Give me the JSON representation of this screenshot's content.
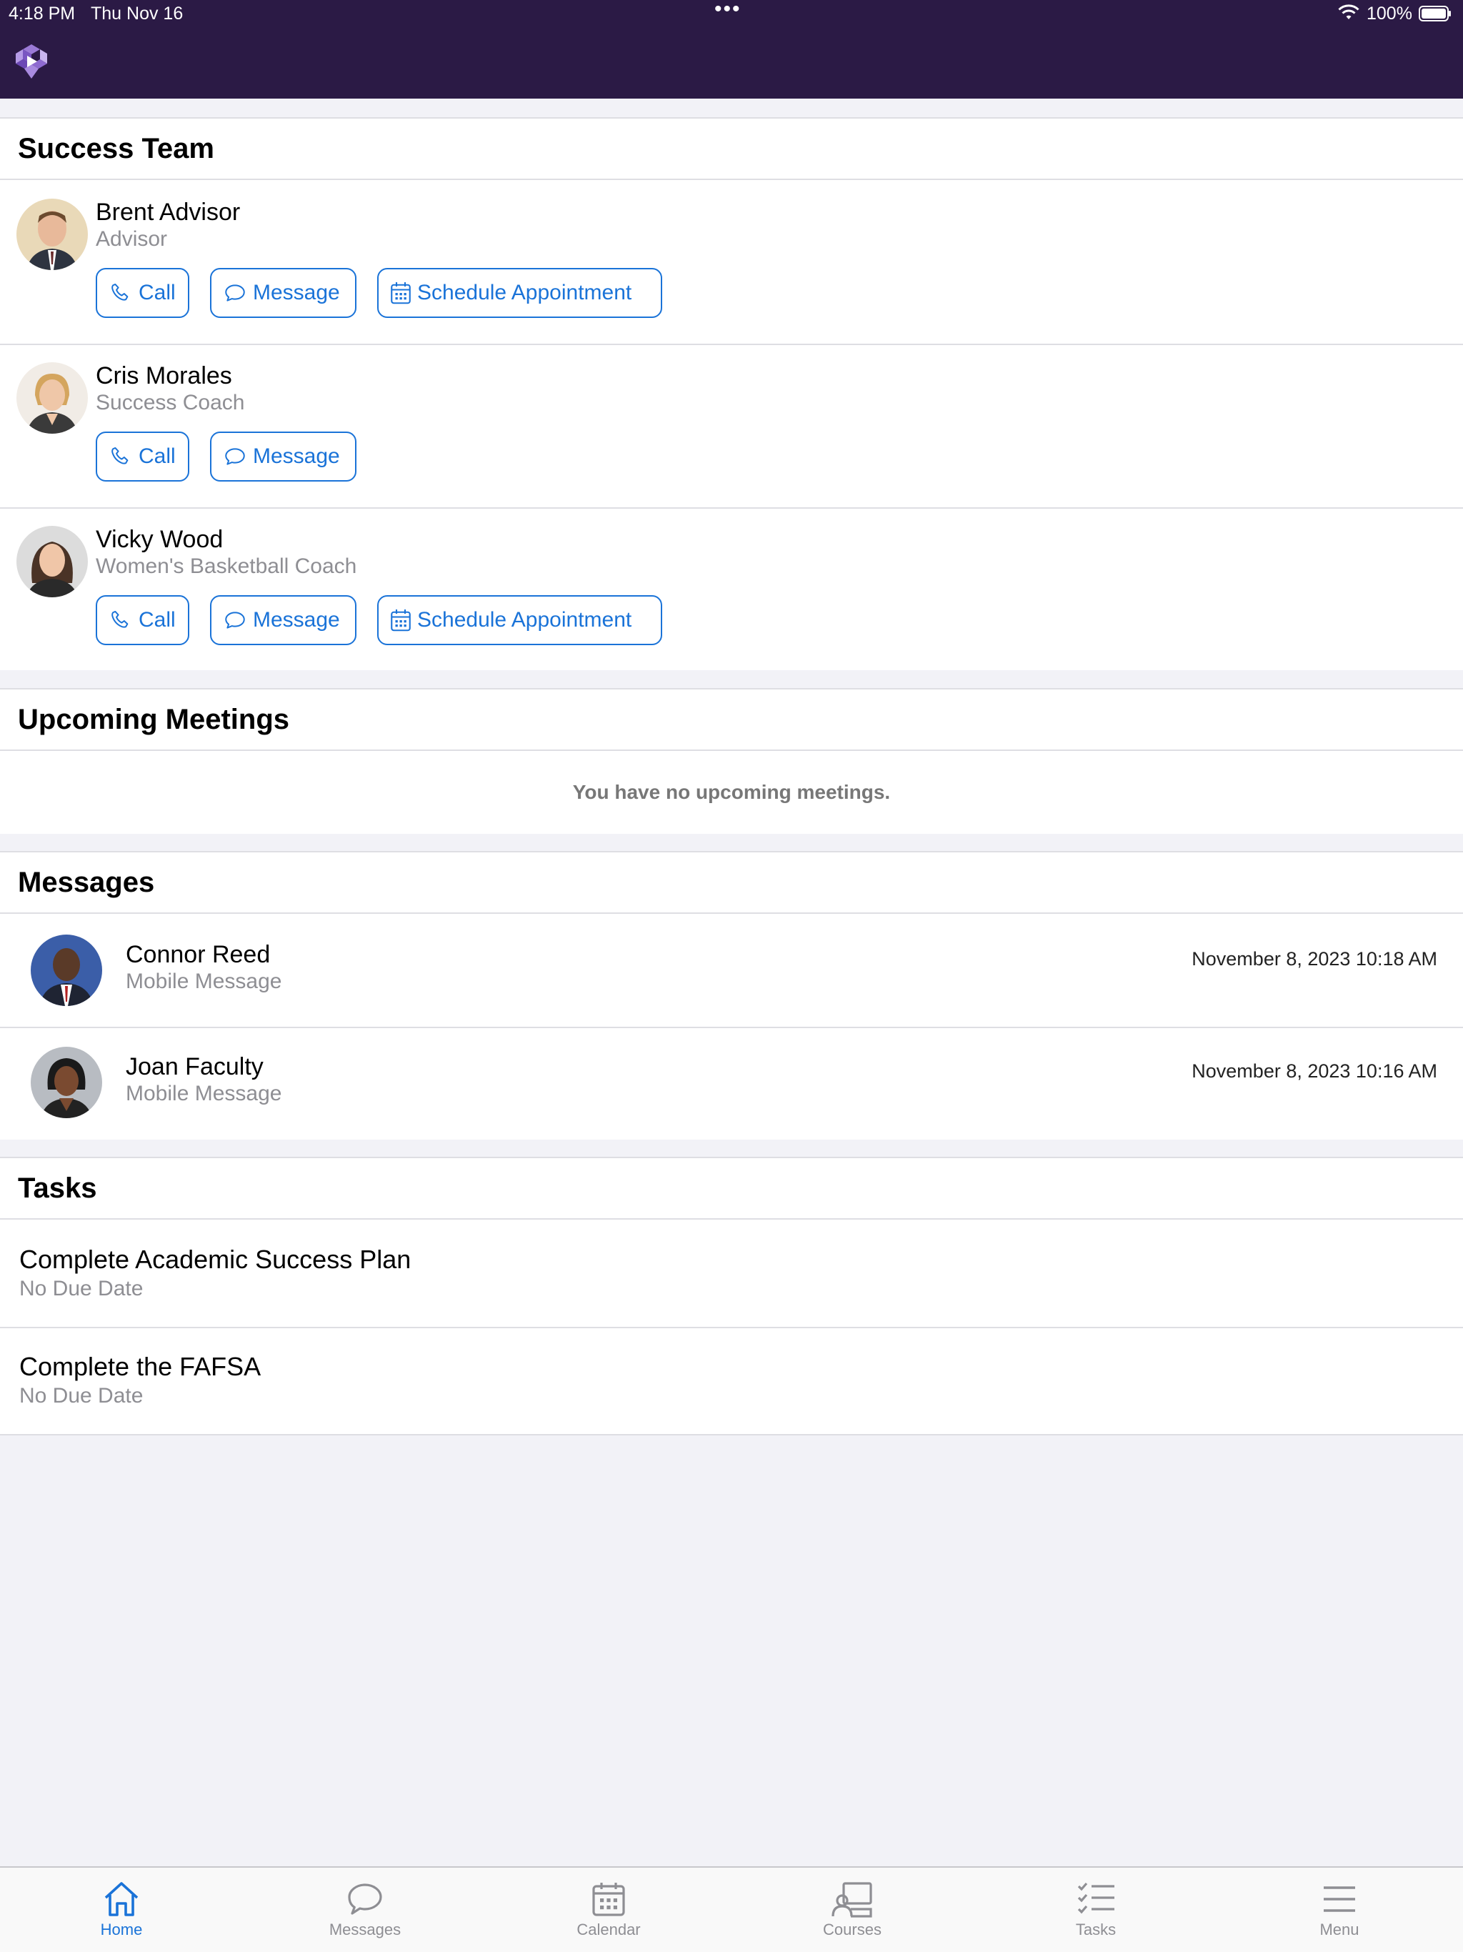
{
  "status": {
    "time": "4:18 PM",
    "date": "Thu Nov 16",
    "multitask_dots": "•••",
    "battery": "100%"
  },
  "success_team": {
    "title": "Success Team",
    "members": [
      {
        "name": "Brent Advisor",
        "role": "Advisor",
        "call": "Call",
        "message": "Message",
        "schedule": "Schedule Appointment"
      },
      {
        "name": "Cris Morales",
        "role": "Success Coach",
        "call": "Call",
        "message": "Message"
      },
      {
        "name": "Vicky Wood",
        "role": "Women's Basketball Coach",
        "call": "Call",
        "message": "Message",
        "schedule": "Schedule Appointment"
      }
    ]
  },
  "meetings": {
    "title": "Upcoming Meetings",
    "empty": "You have no upcoming meetings."
  },
  "messages": {
    "title": "Messages",
    "items": [
      {
        "name": "Connor Reed",
        "type": "Mobile Message",
        "date": "November 8, 2023 10:18 AM"
      },
      {
        "name": "Joan Faculty",
        "type": "Mobile Message",
        "date": "November 8, 2023 10:16 AM"
      }
    ]
  },
  "tasks": {
    "title": "Tasks",
    "items": [
      {
        "title": "Complete Academic Success Plan",
        "due": "No Due Date"
      },
      {
        "title": "Complete the FAFSA",
        "due": "No Due Date"
      }
    ]
  },
  "tabs": [
    {
      "label": "Home",
      "icon": "home-icon",
      "active": true
    },
    {
      "label": "Messages",
      "icon": "chat-bubble-icon"
    },
    {
      "label": "Calendar",
      "icon": "calendar-icon"
    },
    {
      "label": "Courses",
      "icon": "courses-icon"
    },
    {
      "label": "Tasks",
      "icon": "checklist-icon"
    },
    {
      "label": "Menu",
      "icon": "hamburger-menu-icon"
    }
  ],
  "colors": {
    "header_bg": "#2b1a45",
    "accent": "#1a73d8",
    "page_bg": "#f2f2f7",
    "secondary_text": "#8e8e93"
  }
}
